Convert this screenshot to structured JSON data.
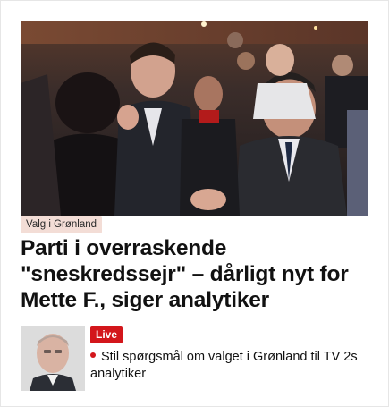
{
  "article": {
    "image_alt": "Crowd celebrating",
    "tag": "Valg i Grønland",
    "headline": "Parti i overraskende \"sneskredssejr\" – dårligt nyt for Mette F., siger analytiker"
  },
  "related": {
    "live_label": "Live",
    "text": "Stil spørgsmål om valget i Grønland til TV 2s analytiker",
    "bullet_color": "#d3161b"
  },
  "colors": {
    "tag_bg": "#f3ddd6",
    "live_bg": "#d3161b",
    "headline": "#111111"
  }
}
